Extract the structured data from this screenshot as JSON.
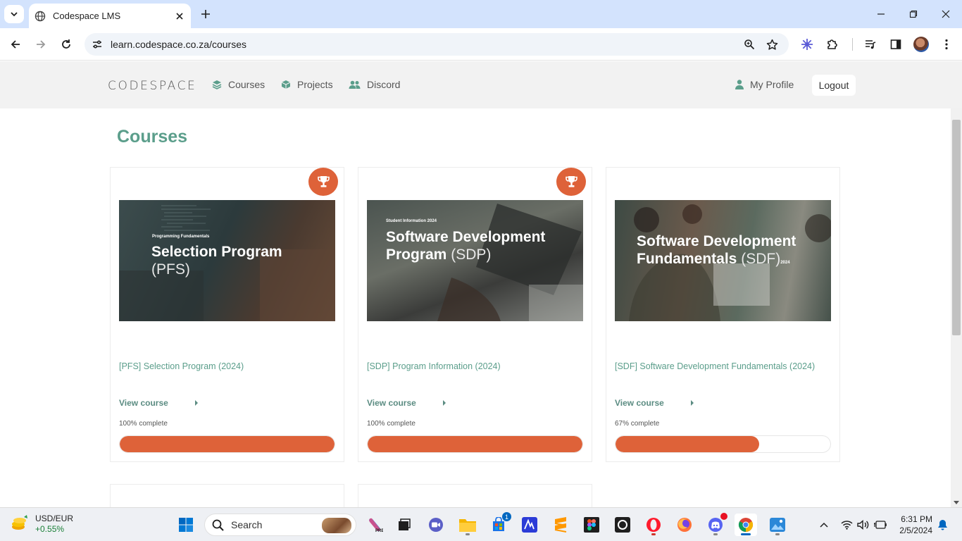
{
  "browser": {
    "tab_title": "Codespace LMS",
    "url": "learn.codespace.co.za/courses"
  },
  "site": {
    "logo": "CODESPACE",
    "nav": [
      {
        "label": "Courses",
        "icon": "layers-icon"
      },
      {
        "label": "Projects",
        "icon": "cube-icon"
      },
      {
        "label": "Discord",
        "icon": "users-icon"
      }
    ],
    "profile_label": "My Profile",
    "logout_label": "Logout"
  },
  "page": {
    "title": "Courses"
  },
  "courses": [
    {
      "banner_sub": "Programming Fundamentals",
      "banner_title": "Selection Program",
      "banner_suffix": "(PFS)",
      "link": "[PFS] Selection Program (2024)",
      "view_label": "View course",
      "complete_text": "100% complete",
      "progress": 100,
      "trophy": true
    },
    {
      "banner_sub": "Student Information 2024",
      "banner_title": "Software Development Program",
      "banner_suffix": "(SDP)",
      "link": "[SDP] Program Information (2024)",
      "view_label": "View course",
      "complete_text": "100% complete",
      "progress": 100,
      "trophy": true
    },
    {
      "banner_sub": "",
      "banner_title": "Software Development Fundamentals",
      "banner_suffix": "(SDF)",
      "banner_year": "2024",
      "link": "[SDF] Software Development Fundamentals (2024)",
      "view_label": "View course",
      "complete_text": "67% complete",
      "progress": 67,
      "trophy": false
    }
  ],
  "taskbar": {
    "ticker_name": "USD/EUR",
    "ticker_change": "+0.55%",
    "search_placeholder": "Search",
    "store_badge": "1",
    "time": "6:31 PM",
    "date": "2/5/2024"
  },
  "colors": {
    "accent": "#de6239",
    "brand_green": "#5b9e8b",
    "tab_bar": "#d3e3fd"
  }
}
